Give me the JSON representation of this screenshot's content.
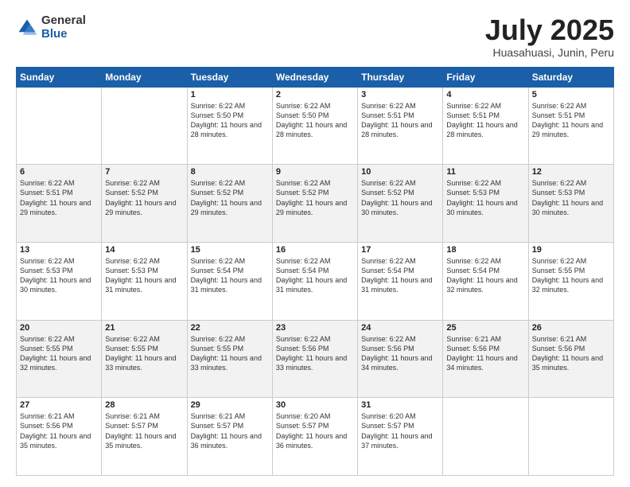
{
  "logo": {
    "general": "General",
    "blue": "Blue"
  },
  "title": {
    "month": "July 2025",
    "location": "Huasahuasi, Junin, Peru"
  },
  "days_of_week": [
    "Sunday",
    "Monday",
    "Tuesday",
    "Wednesday",
    "Thursday",
    "Friday",
    "Saturday"
  ],
  "weeks": [
    [
      {
        "day": "",
        "sunrise": "",
        "sunset": "",
        "daylight": ""
      },
      {
        "day": "",
        "sunrise": "",
        "sunset": "",
        "daylight": ""
      },
      {
        "day": "1",
        "sunrise": "Sunrise: 6:22 AM",
        "sunset": "Sunset: 5:50 PM",
        "daylight": "Daylight: 11 hours and 28 minutes."
      },
      {
        "day": "2",
        "sunrise": "Sunrise: 6:22 AM",
        "sunset": "Sunset: 5:50 PM",
        "daylight": "Daylight: 11 hours and 28 minutes."
      },
      {
        "day": "3",
        "sunrise": "Sunrise: 6:22 AM",
        "sunset": "Sunset: 5:51 PM",
        "daylight": "Daylight: 11 hours and 28 minutes."
      },
      {
        "day": "4",
        "sunrise": "Sunrise: 6:22 AM",
        "sunset": "Sunset: 5:51 PM",
        "daylight": "Daylight: 11 hours and 28 minutes."
      },
      {
        "day": "5",
        "sunrise": "Sunrise: 6:22 AM",
        "sunset": "Sunset: 5:51 PM",
        "daylight": "Daylight: 11 hours and 29 minutes."
      }
    ],
    [
      {
        "day": "6",
        "sunrise": "Sunrise: 6:22 AM",
        "sunset": "Sunset: 5:51 PM",
        "daylight": "Daylight: 11 hours and 29 minutes."
      },
      {
        "day": "7",
        "sunrise": "Sunrise: 6:22 AM",
        "sunset": "Sunset: 5:52 PM",
        "daylight": "Daylight: 11 hours and 29 minutes."
      },
      {
        "day": "8",
        "sunrise": "Sunrise: 6:22 AM",
        "sunset": "Sunset: 5:52 PM",
        "daylight": "Daylight: 11 hours and 29 minutes."
      },
      {
        "day": "9",
        "sunrise": "Sunrise: 6:22 AM",
        "sunset": "Sunset: 5:52 PM",
        "daylight": "Daylight: 11 hours and 29 minutes."
      },
      {
        "day": "10",
        "sunrise": "Sunrise: 6:22 AM",
        "sunset": "Sunset: 5:52 PM",
        "daylight": "Daylight: 11 hours and 30 minutes."
      },
      {
        "day": "11",
        "sunrise": "Sunrise: 6:22 AM",
        "sunset": "Sunset: 5:53 PM",
        "daylight": "Daylight: 11 hours and 30 minutes."
      },
      {
        "day": "12",
        "sunrise": "Sunrise: 6:22 AM",
        "sunset": "Sunset: 5:53 PM",
        "daylight": "Daylight: 11 hours and 30 minutes."
      }
    ],
    [
      {
        "day": "13",
        "sunrise": "Sunrise: 6:22 AM",
        "sunset": "Sunset: 5:53 PM",
        "daylight": "Daylight: 11 hours and 30 minutes."
      },
      {
        "day": "14",
        "sunrise": "Sunrise: 6:22 AM",
        "sunset": "Sunset: 5:53 PM",
        "daylight": "Daylight: 11 hours and 31 minutes."
      },
      {
        "day": "15",
        "sunrise": "Sunrise: 6:22 AM",
        "sunset": "Sunset: 5:54 PM",
        "daylight": "Daylight: 11 hours and 31 minutes."
      },
      {
        "day": "16",
        "sunrise": "Sunrise: 6:22 AM",
        "sunset": "Sunset: 5:54 PM",
        "daylight": "Daylight: 11 hours and 31 minutes."
      },
      {
        "day": "17",
        "sunrise": "Sunrise: 6:22 AM",
        "sunset": "Sunset: 5:54 PM",
        "daylight": "Daylight: 11 hours and 31 minutes."
      },
      {
        "day": "18",
        "sunrise": "Sunrise: 6:22 AM",
        "sunset": "Sunset: 5:54 PM",
        "daylight": "Daylight: 11 hours and 32 minutes."
      },
      {
        "day": "19",
        "sunrise": "Sunrise: 6:22 AM",
        "sunset": "Sunset: 5:55 PM",
        "daylight": "Daylight: 11 hours and 32 minutes."
      }
    ],
    [
      {
        "day": "20",
        "sunrise": "Sunrise: 6:22 AM",
        "sunset": "Sunset: 5:55 PM",
        "daylight": "Daylight: 11 hours and 32 minutes."
      },
      {
        "day": "21",
        "sunrise": "Sunrise: 6:22 AM",
        "sunset": "Sunset: 5:55 PM",
        "daylight": "Daylight: 11 hours and 33 minutes."
      },
      {
        "day": "22",
        "sunrise": "Sunrise: 6:22 AM",
        "sunset": "Sunset: 5:55 PM",
        "daylight": "Daylight: 11 hours and 33 minutes."
      },
      {
        "day": "23",
        "sunrise": "Sunrise: 6:22 AM",
        "sunset": "Sunset: 5:56 PM",
        "daylight": "Daylight: 11 hours and 33 minutes."
      },
      {
        "day": "24",
        "sunrise": "Sunrise: 6:22 AM",
        "sunset": "Sunset: 5:56 PM",
        "daylight": "Daylight: 11 hours and 34 minutes."
      },
      {
        "day": "25",
        "sunrise": "Sunrise: 6:21 AM",
        "sunset": "Sunset: 5:56 PM",
        "daylight": "Daylight: 11 hours and 34 minutes."
      },
      {
        "day": "26",
        "sunrise": "Sunrise: 6:21 AM",
        "sunset": "Sunset: 5:56 PM",
        "daylight": "Daylight: 11 hours and 35 minutes."
      }
    ],
    [
      {
        "day": "27",
        "sunrise": "Sunrise: 6:21 AM",
        "sunset": "Sunset: 5:56 PM",
        "daylight": "Daylight: 11 hours and 35 minutes."
      },
      {
        "day": "28",
        "sunrise": "Sunrise: 6:21 AM",
        "sunset": "Sunset: 5:57 PM",
        "daylight": "Daylight: 11 hours and 35 minutes."
      },
      {
        "day": "29",
        "sunrise": "Sunrise: 6:21 AM",
        "sunset": "Sunset: 5:57 PM",
        "daylight": "Daylight: 11 hours and 36 minutes."
      },
      {
        "day": "30",
        "sunrise": "Sunrise: 6:20 AM",
        "sunset": "Sunset: 5:57 PM",
        "daylight": "Daylight: 11 hours and 36 minutes."
      },
      {
        "day": "31",
        "sunrise": "Sunrise: 6:20 AM",
        "sunset": "Sunset: 5:57 PM",
        "daylight": "Daylight: 11 hours and 37 minutes."
      },
      {
        "day": "",
        "sunrise": "",
        "sunset": "",
        "daylight": ""
      },
      {
        "day": "",
        "sunrise": "",
        "sunset": "",
        "daylight": ""
      }
    ]
  ]
}
